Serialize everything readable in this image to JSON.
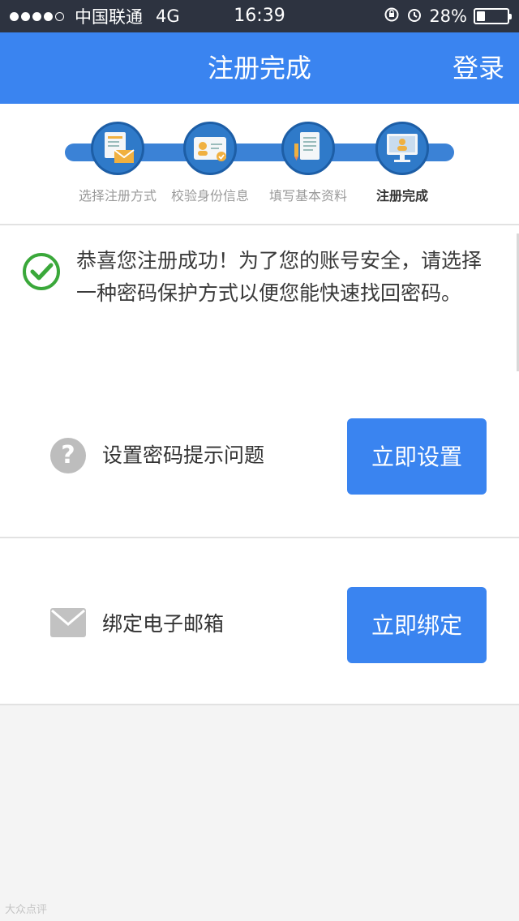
{
  "status_bar": {
    "carrier": "中国联通",
    "network": "4G",
    "time": "16:39",
    "battery_percent": "28%",
    "battery_level": 0.28
  },
  "nav": {
    "title": "注册完成",
    "login_label": "登录"
  },
  "steps": [
    {
      "label": "选择注册方式",
      "icon": "register-method-icon"
    },
    {
      "label": "校验身份信息",
      "icon": "id-card-icon"
    },
    {
      "label": "填写基本资料",
      "icon": "document-icon"
    },
    {
      "label": "注册完成",
      "icon": "computer-user-icon",
      "active": true
    }
  ],
  "success": {
    "message": "恭喜您注册成功！为了您的账号安全，请选择一种密码保护方式以便您能快速找回密码。"
  },
  "options": [
    {
      "label": "设置密码提示问题",
      "button": "立即设置",
      "icon": "question-icon"
    },
    {
      "label": "绑定电子邮箱",
      "button": "立即绑定",
      "icon": "mail-icon"
    }
  ],
  "watermark": "大众点评",
  "colors": {
    "accent": "#3a84f0",
    "status_bar": "#2d3340",
    "success_green": "#3aa83a"
  }
}
